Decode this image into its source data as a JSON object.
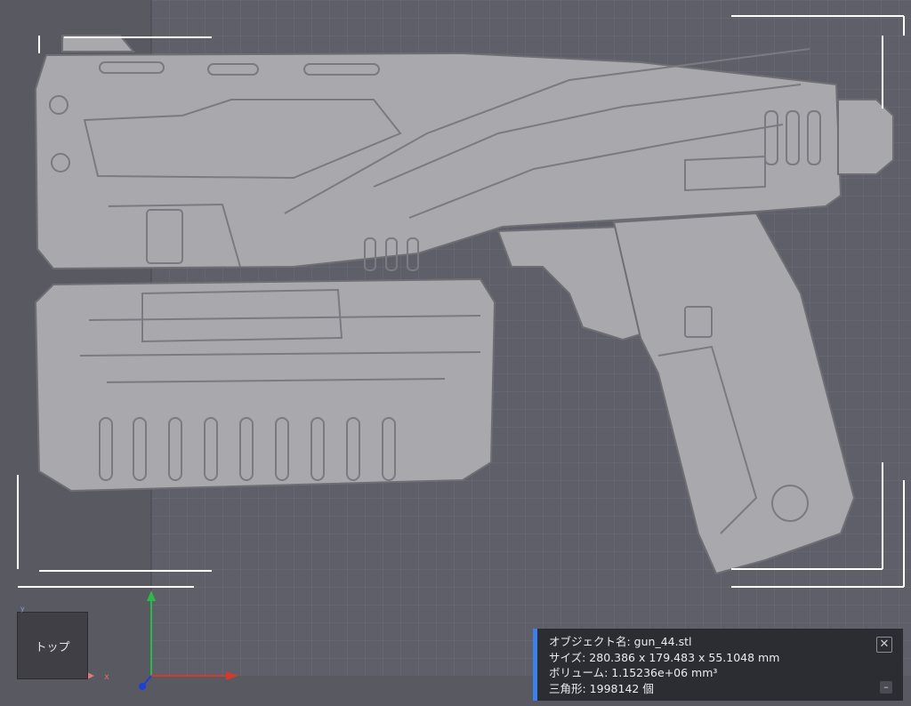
{
  "viewport": {
    "background_color": "#595962",
    "grid_color": "#6b6b76",
    "model_color": "#a9a9ad",
    "model_shadow_color": "#7c7c82",
    "axis_colors": {
      "x": "#d23a2e",
      "y": "#2db84a",
      "z": "#1f3fd6",
      "mini_x": "#e07b7b",
      "mini_y": "#8a9be0"
    }
  },
  "view_cube": {
    "label": "トップ"
  },
  "axis_labels": {
    "x": "x",
    "y": "y"
  },
  "info_panel": {
    "accent_color": "#3f7fe8",
    "object_name": "オブジェクト名: gun_44.stl",
    "size": "サイズ: 280.386 x 179.483 x 55.1048 mm",
    "volume": "ボリューム: 1.15236e+06 mm³",
    "triangles": "三角形: 1998142 個",
    "close_icon": "close-icon",
    "minimize_icon": "minimize-icon"
  }
}
